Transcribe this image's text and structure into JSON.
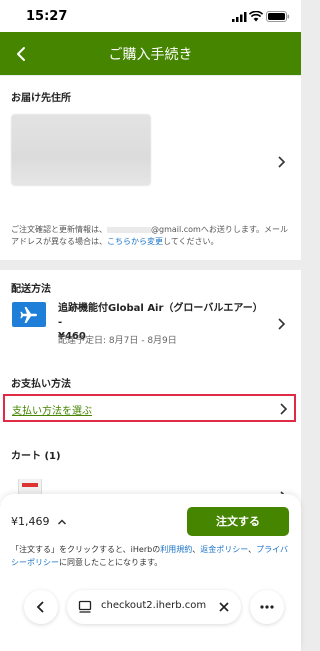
{
  "status_bar": {
    "time": "15:27"
  },
  "header": {
    "title": "ご購入手続き"
  },
  "address": {
    "title": "お届け先住所",
    "note_prefix": "ご注文確認と更新情報は、",
    "note_email": "@gmail.com",
    "note_middle": "へお送りします。メールアドレスが異なる場合は、",
    "note_link": "こちらから変更",
    "note_suffix": "してください。"
  },
  "shipping": {
    "title": "配送方法",
    "method_name": "追跡機能付Global Air（グローバルエアー） -",
    "price": "¥460",
    "eta": "配達予定日: 8月7日 - 8月9日"
  },
  "payment": {
    "title": "お支払い方法",
    "select_label": "支払い方法を選ぶ"
  },
  "cart": {
    "title": "カート (1)"
  },
  "footer": {
    "total": "¥1,469",
    "order_button": "注文する",
    "terms_prefix": "「注文する」をクリックすると、iHerbの",
    "terms_link1": "利用規約",
    "terms_sep": "、",
    "terms_link2": "返金ポリシー",
    "terms_sep2": "、",
    "terms_link3": "プライバシーポリシー",
    "terms_suffix": "に同意したことになります。"
  },
  "browser": {
    "url": "checkout2.iherb.com"
  },
  "colors": {
    "brand_green": "#458500",
    "link_blue": "#1a73c8",
    "highlight_red": "#e02b47"
  }
}
